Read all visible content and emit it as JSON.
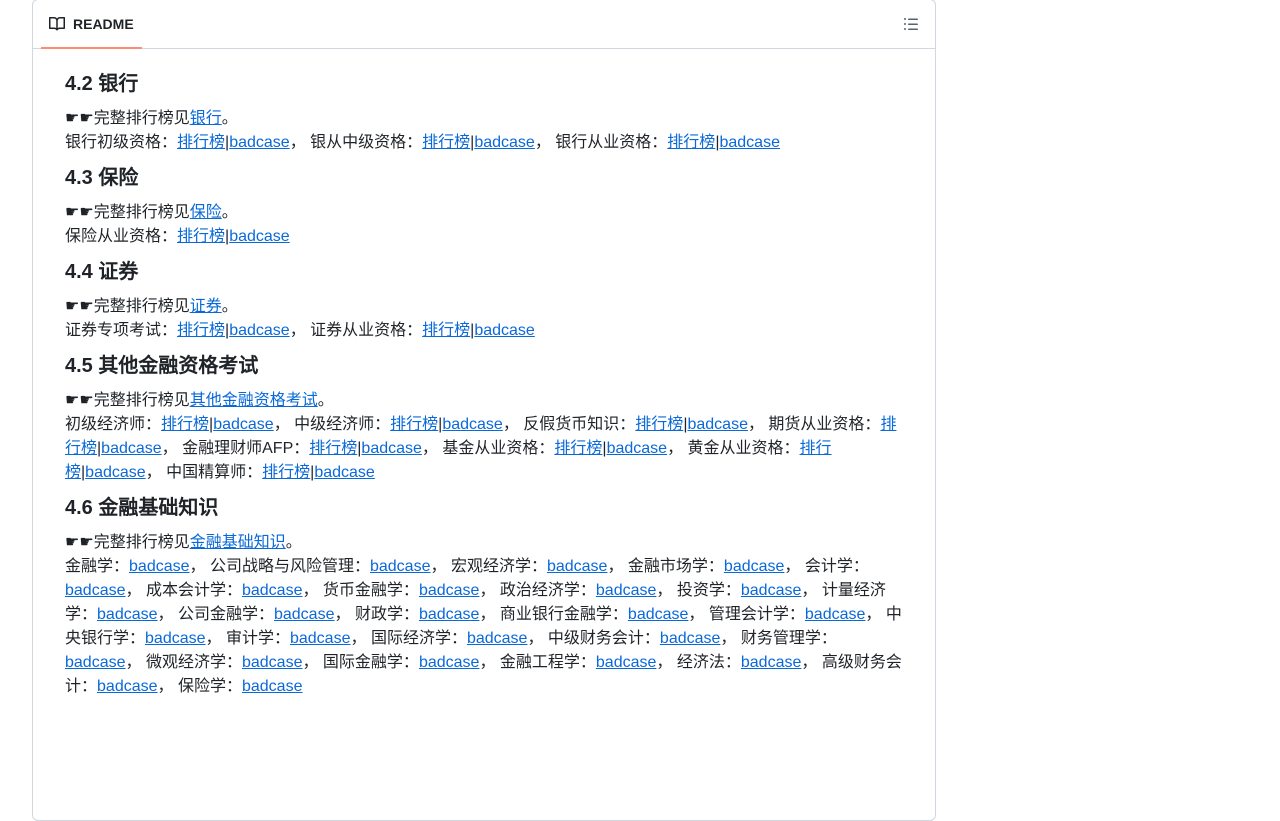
{
  "header": {
    "tab_label": "README"
  },
  "sections": [
    {
      "title": "4.2 银行",
      "pointer": "☛☛完整排行榜见",
      "pointer_link": "银行",
      "pointer_end": "。",
      "items": [
        {
          "label": "银行初级资格：",
          "rank": "排行榜",
          "sep": "|",
          "bad": "badcase",
          "tail": "， "
        },
        {
          "label": "银从中级资格：",
          "rank": "排行榜",
          "sep": "|",
          "bad": "badcase",
          "tail": "， "
        },
        {
          "label": "银行从业资格：",
          "rank": "排行榜",
          "sep": "|",
          "bad": "badcase",
          "tail": ""
        }
      ]
    },
    {
      "title": "4.3 保险",
      "pointer": "☛☛完整排行榜见",
      "pointer_link": "保险",
      "pointer_end": "。",
      "items": [
        {
          "label": "保险从业资格：",
          "rank": "排行榜",
          "sep": "|",
          "bad": "badcase",
          "tail": ""
        }
      ]
    },
    {
      "title": "4.4 证券",
      "pointer": "☛☛完整排行榜见",
      "pointer_link": "证券",
      "pointer_end": "。",
      "items": [
        {
          "label": "证券专项考试：",
          "rank": "排行榜",
          "sep": "|",
          "bad": "badcase",
          "tail": "， "
        },
        {
          "label": "证券从业资格：",
          "rank": "排行榜",
          "sep": "|",
          "bad": "badcase",
          "tail": ""
        }
      ]
    },
    {
      "title": "4.5 其他金融资格考试",
      "pointer": "☛☛完整排行榜见",
      "pointer_link": "其他金融资格考试",
      "pointer_end": "。",
      "items": [
        {
          "label": "初级经济师：",
          "rank": "排行榜",
          "sep": "|",
          "bad": "badcase",
          "tail": "， "
        },
        {
          "label": "中级经济师：",
          "rank": "排行榜",
          "sep": "|",
          "bad": "badcase",
          "tail": "， "
        },
        {
          "label": "反假货币知识：",
          "rank": "排行榜",
          "sep": "|",
          "bad": "badcase",
          "tail": "， "
        },
        {
          "label": "期货从业资格：",
          "rank": "排行榜",
          "sep": "|",
          "bad": "badcase",
          "tail": "， "
        },
        {
          "label": "金融理财师AFP：",
          "rank": "排行榜",
          "sep": "|",
          "bad": "badcase",
          "tail": "， "
        },
        {
          "label": "基金从业资格：",
          "rank": "排行榜",
          "sep": "|",
          "bad": "badcase",
          "tail": "， "
        },
        {
          "label": "黄金从业资格：",
          "rank": "排行榜",
          "sep": "|",
          "bad": "badcase",
          "tail": "， "
        },
        {
          "label": "中国精算师：",
          "rank": "排行榜",
          "sep": "|",
          "bad": "badcase",
          "tail": ""
        }
      ]
    },
    {
      "title": "4.6 金融基础知识",
      "pointer": "☛☛完整排行榜见",
      "pointer_link": "金融基础知识",
      "pointer_end": "。",
      "items": [
        {
          "label": "金融学：",
          "bad": "badcase",
          "tail": "， "
        },
        {
          "label": "公司战略与风险管理：",
          "bad": "badcase",
          "tail": "， "
        },
        {
          "label": "宏观经济学：",
          "bad": "badcase",
          "tail": "， "
        },
        {
          "label": "金融市场学：",
          "bad": "badcase",
          "tail": "， "
        },
        {
          "label": "会计学：",
          "bad": "badcase",
          "tail": "， "
        },
        {
          "label": "成本会计学：",
          "bad": "badcase",
          "tail": "， "
        },
        {
          "label": "货币金融学：",
          "bad": "badcase",
          "tail": "， "
        },
        {
          "label": "政治经济学：",
          "bad": "badcase",
          "tail": "， "
        },
        {
          "label": "投资学：",
          "bad": "badcase",
          "tail": "， "
        },
        {
          "label": "计量经济学：",
          "bad": "badcase",
          "tail": "， "
        },
        {
          "label": "公司金融学：",
          "bad": "badcase",
          "tail": "， "
        },
        {
          "label": "财政学：",
          "bad": "badcase",
          "tail": "， "
        },
        {
          "label": "商业银行金融学：",
          "bad": "badcase",
          "tail": "， "
        },
        {
          "label": "管理会计学：",
          "bad": "badcase",
          "tail": "， "
        },
        {
          "label": "中央银行学：",
          "bad": "badcase",
          "tail": "， "
        },
        {
          "label": "审计学：",
          "bad": "badcase",
          "tail": "， "
        },
        {
          "label": "国际经济学：",
          "bad": "badcase",
          "tail": "， "
        },
        {
          "label": "中级财务会计：",
          "bad": "badcase",
          "tail": "， "
        },
        {
          "label": "财务管理学：",
          "bad": "badcase",
          "tail": "， "
        },
        {
          "label": "微观经济学：",
          "bad": "badcase",
          "tail": "， "
        },
        {
          "label": "国际金融学：",
          "bad": "badcase",
          "tail": "， "
        },
        {
          "label": "金融工程学：",
          "bad": "badcase",
          "tail": "， "
        },
        {
          "label": "经济法：",
          "bad": "badcase",
          "tail": "， "
        },
        {
          "label": "高级财务会计：",
          "bad": "badcase",
          "tail": "， "
        },
        {
          "label": "保险学：",
          "bad": "badcase",
          "tail": ""
        }
      ]
    }
  ]
}
